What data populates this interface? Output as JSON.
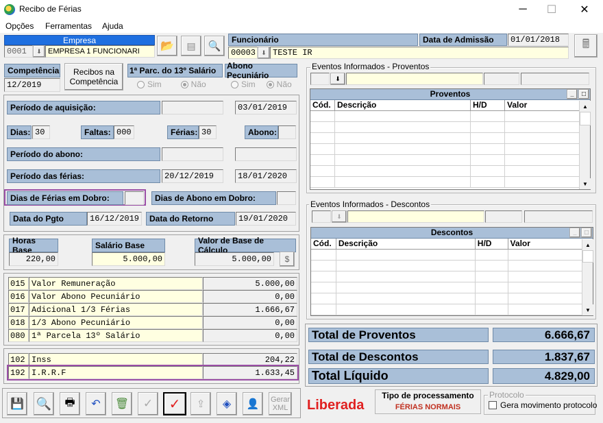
{
  "window": {
    "title": "Recibo de Férias",
    "minimize": "─",
    "maximize": "☐",
    "close": "✕"
  },
  "menu": [
    "Opções",
    "Ferramentas",
    "Ajuda"
  ],
  "empresa": {
    "label": "Empresa",
    "code": "0001",
    "name": "EMPRESA 1 FUNCIONARI"
  },
  "funcionario": {
    "label": "Funcionário",
    "code": "00003",
    "name": "TESTE IR"
  },
  "admissao": {
    "label": "Data de Admissão",
    "value": "01/01/2018"
  },
  "competencia": {
    "label": "Competência",
    "value": "12/2019"
  },
  "recibos_btn": "Recibos na Competência",
  "parc13": {
    "label": "1ª Parc. do 13º Salário",
    "sim": "Sim",
    "nao": "Não"
  },
  "abono_pec": {
    "label": "Abono Pecuniário",
    "sim": "Sim",
    "nao": "Não"
  },
  "periodo_aquisicao": {
    "label": "Período de aquisição:",
    "start": "",
    "end": "03/01/2019"
  },
  "dias": {
    "label": "Dias:",
    "value": "30"
  },
  "faltas": {
    "label": "Faltas:",
    "value": "000"
  },
  "ferias": {
    "label": "Férias:",
    "value": "30"
  },
  "abono": {
    "label": "Abono:",
    "value": ""
  },
  "periodo_abono": {
    "label": "Período do abono:",
    "start": "",
    "end": ""
  },
  "periodo_ferias": {
    "label": "Período das férias:",
    "start": "20/12/2019",
    "end": "18/01/2020"
  },
  "dias_ferias_dobro": {
    "label": "Dias de Férias em Dobro:",
    "value": ""
  },
  "dias_abono_dobro": {
    "label": "Dias de Abono em Dobro:",
    "value": ""
  },
  "data_pgto": {
    "label": "Data do Pgto",
    "value": "16/12/2019"
  },
  "data_retorno": {
    "label": "Data do Retorno",
    "value": "19/01/2020"
  },
  "horas_base": {
    "label": "Horas Base",
    "value": "220,00"
  },
  "salario_base": {
    "label": "Salário Base",
    "value": "5.000,00"
  },
  "valor_base": {
    "label": "Valor de Base de Cálculo",
    "value": "5.000,00"
  },
  "rubricas": [
    {
      "code": "015",
      "desc": "Valor Remuneração",
      "value": "5.000,00"
    },
    {
      "code": "016",
      "desc": "Valor Abono Pecuniário",
      "value": "0,00"
    },
    {
      "code": "017",
      "desc": "Adicional 1/3 Férias",
      "value": "1.666,67"
    },
    {
      "code": "018",
      "desc": "1/3 Abono Pecuniário",
      "value": "0,00"
    },
    {
      "code": "080",
      "desc": "1ª Parcela 13º Salário",
      "value": "0,00"
    }
  ],
  "descontos_rub": [
    {
      "code": "102",
      "desc": "Inss",
      "value": "204,22"
    },
    {
      "code": "192",
      "desc": "I.R.R.F",
      "value": "1.633,45"
    }
  ],
  "eventos_proventos": {
    "group": "Eventos Informados - Proventos",
    "grid_title": "Proventos",
    "cols": [
      "Cód.",
      "Descrição",
      "H/D",
      "Valor"
    ]
  },
  "eventos_descontos": {
    "group": "Eventos Informados - Descontos",
    "grid_title": "Descontos",
    "cols": [
      "Cód.",
      "Descrição",
      "H/D",
      "Valor"
    ]
  },
  "totais": {
    "proventos": {
      "label": "Total de Proventos",
      "value": "6.666,67"
    },
    "descontos": {
      "label": "Total de Descontos",
      "value": "1.837,67"
    },
    "liquido": {
      "label": "Total Líquido",
      "value": "4.829,00"
    }
  },
  "status": {
    "text": "Liberada",
    "color": "#e02020"
  },
  "tipo_processamento": {
    "label": "Tipo de processamento",
    "value": "FÉRIAS NORMAIS"
  },
  "protocolo": {
    "label": "Protocolo",
    "checkbox": "Gera movimento protocolo"
  },
  "toolbar": {
    "gerar_xml": "Gerar XML"
  }
}
